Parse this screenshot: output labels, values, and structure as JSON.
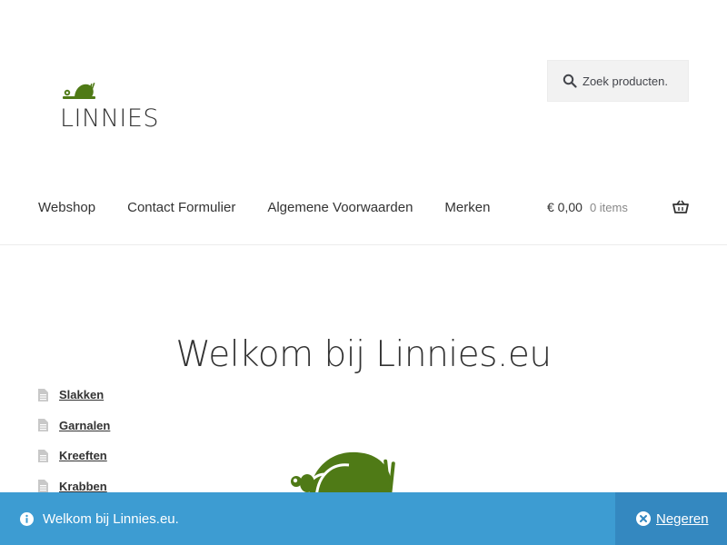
{
  "header": {
    "logo_text": "LINNIES",
    "search": {
      "placeholder": "Zoek producten."
    }
  },
  "nav": {
    "items": [
      {
        "label": "Webshop"
      },
      {
        "label": "Contact Formulier"
      },
      {
        "label": "Algemene Voorwaarden"
      },
      {
        "label": "Merken"
      }
    ]
  },
  "cart": {
    "amount": "€ 0,00",
    "count": "0 items"
  },
  "main": {
    "title": "Welkom bij Linnies.eu"
  },
  "sidebar": {
    "items": [
      {
        "label": "Slakken"
      },
      {
        "label": "Garnalen"
      },
      {
        "label": "Kreeften"
      },
      {
        "label": "Krabben"
      }
    ]
  },
  "notice": {
    "message": "Welkom bij Linnies.eu.",
    "dismiss_label": "Negeren"
  },
  "colors": {
    "brand_green": "#4f7a16",
    "notice_bg": "#3d9cd2",
    "notice_dismiss_bg": "#3488c0"
  },
  "icons": {
    "search": "search-icon",
    "basket": "basket-icon",
    "document": "document-icon",
    "info": "info-icon",
    "close": "close-circle-icon"
  }
}
